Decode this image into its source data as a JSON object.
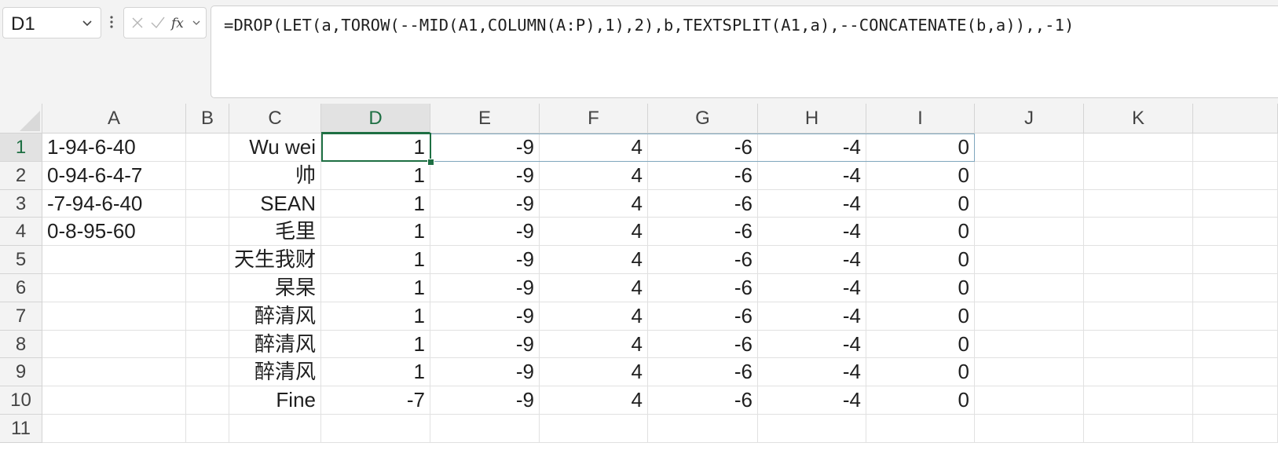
{
  "formula_bar": {
    "name_box": "D1",
    "formula": "=DROP(LET(a,TOROW(--MID(A1,COLUMN(A:P),1),2),b,TEXTSPLIT(A1,a),--CONCATENATE(b,a)),,-1)"
  },
  "icons": {
    "name_box_dropdown": "chevron-down-icon",
    "more": "vertical-dots-icon",
    "cancel": "close-icon",
    "enter": "check-icon",
    "insert_function": "fx-icon"
  },
  "colors": {
    "accent": "#1e6f43",
    "spill_border": "#7fa6bd",
    "header_bg": "#f3f3f3"
  },
  "sheet": {
    "columns": [
      "A",
      "B",
      "C",
      "D",
      "E",
      "F",
      "G",
      "H",
      "I",
      "J",
      "K"
    ],
    "active_column": "D",
    "active_row": "1",
    "rows": [
      {
        "n": "1",
        "A": "1-94-6-40",
        "C": "Wu wei",
        "D": "1",
        "E": "-9",
        "F": "4",
        "G": "-6",
        "H": "-4",
        "I": "0"
      },
      {
        "n": "2",
        "A": "0-94-6-4-7",
        "C": "帅",
        "D": "1",
        "E": "-9",
        "F": "4",
        "G": "-6",
        "H": "-4",
        "I": "0"
      },
      {
        "n": "3",
        "A": "-7-94-6-40",
        "C": "SEAN",
        "D": "1",
        "E": "-9",
        "F": "4",
        "G": "-6",
        "H": "-4",
        "I": "0"
      },
      {
        "n": "4",
        "A": "0-8-95-60",
        "C": "毛里",
        "D": "1",
        "E": "-9",
        "F": "4",
        "G": "-6",
        "H": "-4",
        "I": "0"
      },
      {
        "n": "5",
        "A": "",
        "C": "天生我财",
        "D": "1",
        "E": "-9",
        "F": "4",
        "G": "-6",
        "H": "-4",
        "I": "0"
      },
      {
        "n": "6",
        "A": "",
        "C": "杲杲",
        "D": "1",
        "E": "-9",
        "F": "4",
        "G": "-6",
        "H": "-4",
        "I": "0"
      },
      {
        "n": "7",
        "A": "",
        "C": "醉清风",
        "D": "1",
        "E": "-9",
        "F": "4",
        "G": "-6",
        "H": "-4",
        "I": "0"
      },
      {
        "n": "8",
        "A": "",
        "C": "醉清风",
        "D": "1",
        "E": "-9",
        "F": "4",
        "G": "-6",
        "H": "-4",
        "I": "0"
      },
      {
        "n": "9",
        "A": "",
        "C": "醉清风",
        "D": "1",
        "E": "-9",
        "F": "4",
        "G": "-6",
        "H": "-4",
        "I": "0"
      },
      {
        "n": "10",
        "A": "",
        "C": "Fine",
        "D": "-7",
        "E": "-9",
        "F": "4",
        "G": "-6",
        "H": "-4",
        "I": "0"
      },
      {
        "n": "11",
        "A": "",
        "C": "",
        "D": "",
        "E": "",
        "F": "",
        "G": "",
        "H": "",
        "I": ""
      }
    ]
  }
}
